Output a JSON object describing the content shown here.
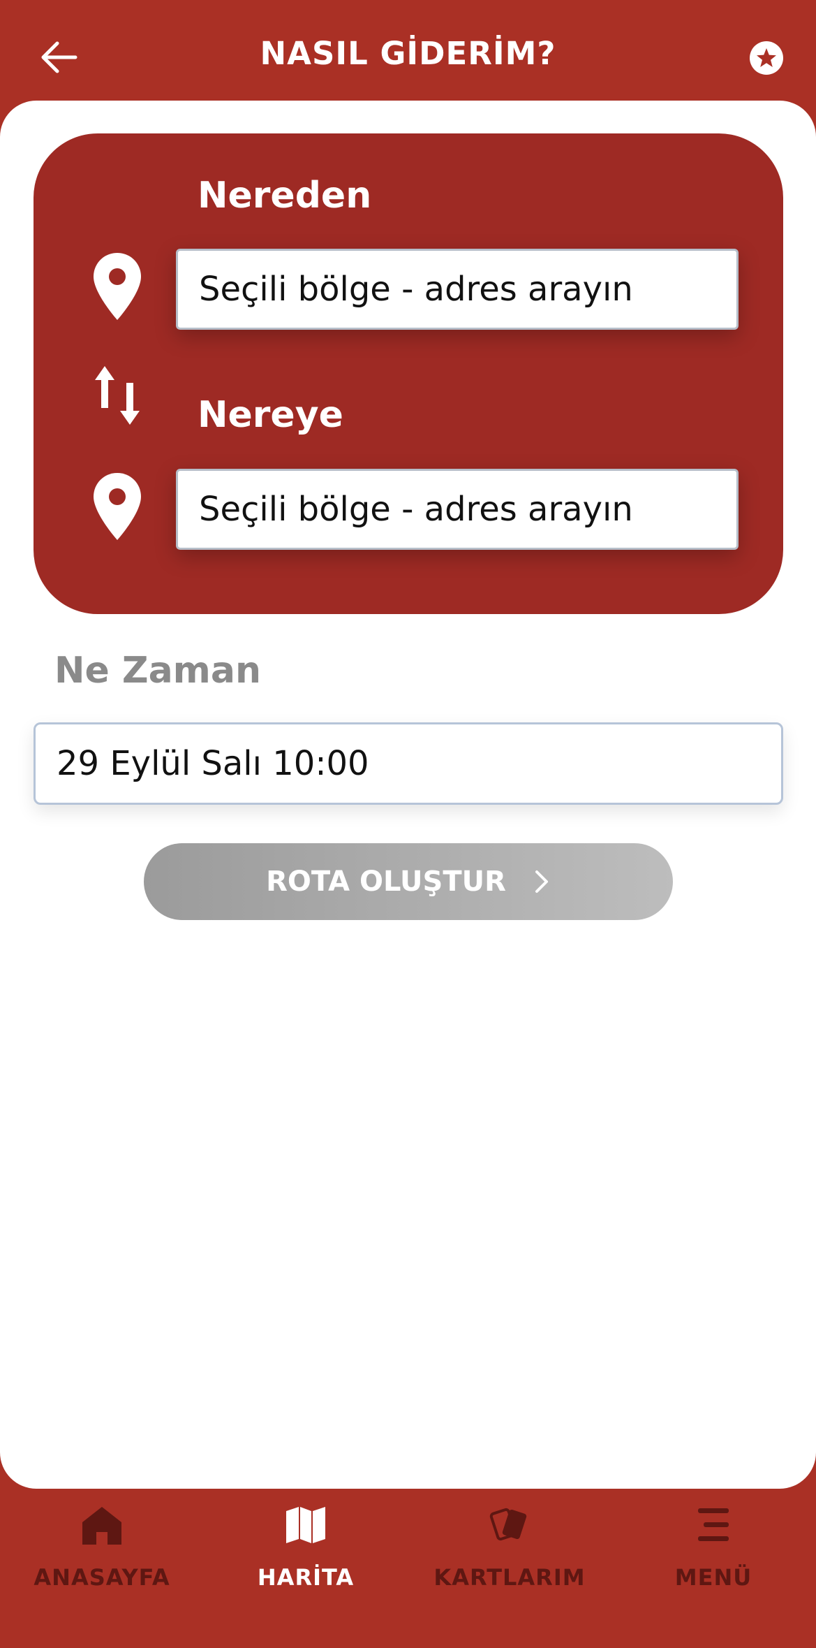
{
  "header": {
    "title": "NASIL GİDERİM?"
  },
  "route": {
    "from_label": "Nereden",
    "from_value": "Seçili bölge - adres arayın",
    "to_label": "Nereye",
    "to_value": "Seçili bölge - adres arayın"
  },
  "when": {
    "label": "Ne Zaman",
    "value": "29 Eylül Salı 10:00"
  },
  "create_route": {
    "label": "ROTA OLUŞTUR"
  },
  "bottom_nav": {
    "items": [
      {
        "label": "ANASAYFA",
        "icon": "home-icon",
        "active": false
      },
      {
        "label": "HARİTA",
        "icon": "map-icon",
        "active": true
      },
      {
        "label": "KARTLARIM",
        "icon": "cards-icon",
        "active": false
      },
      {
        "label": "MENÜ",
        "icon": "menu-icon",
        "active": false
      }
    ]
  },
  "colors": {
    "brand_red": "#AA3025",
    "card_red": "#9E2A24",
    "nav_inactive": "#5E1712",
    "button_gray": "#A8A8A8"
  }
}
